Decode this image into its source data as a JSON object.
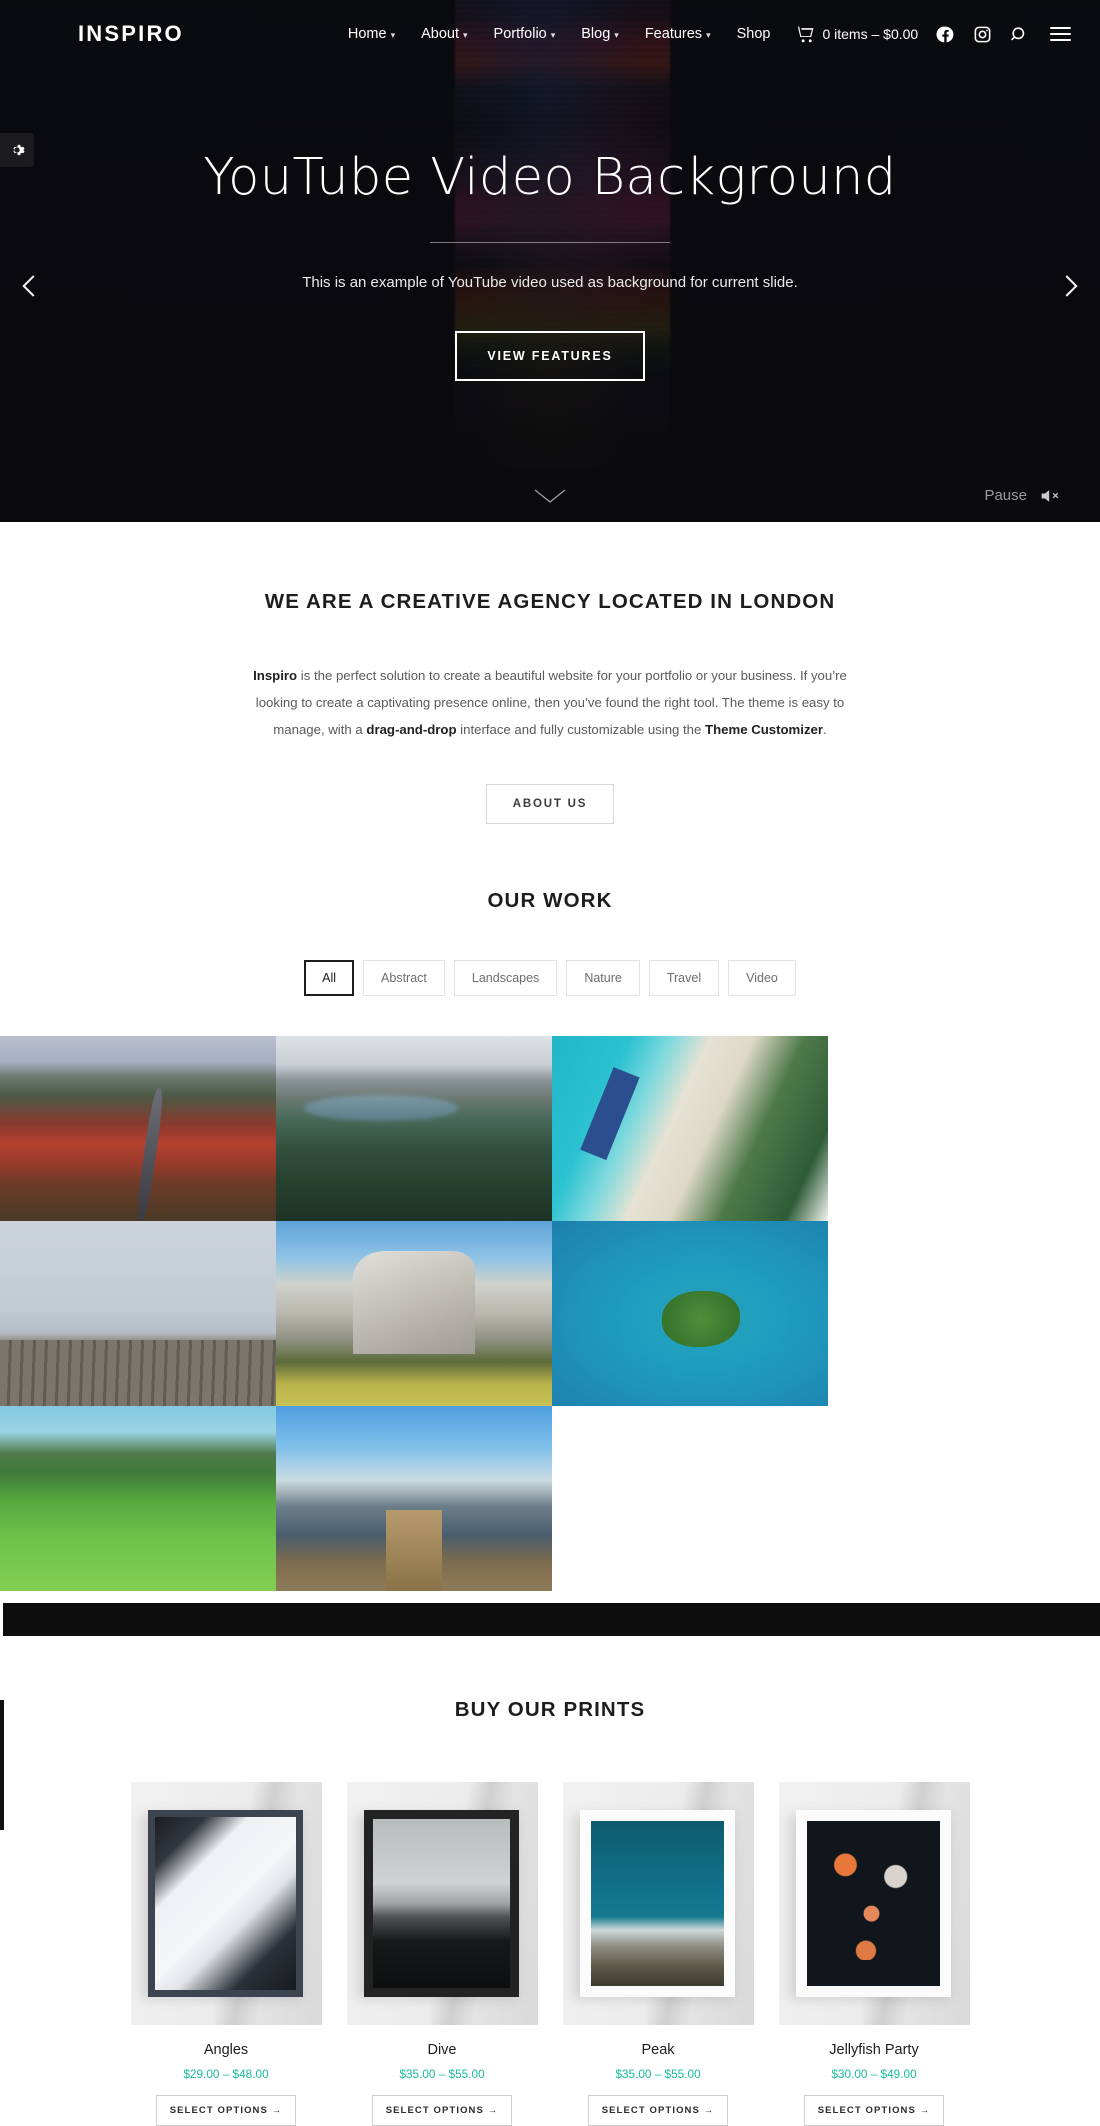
{
  "header": {
    "logo": "INSPIRO",
    "nav": [
      {
        "label": "Home",
        "caret": "⌄"
      },
      {
        "label": "About",
        "caret": "⌄"
      },
      {
        "label": "Portfolio",
        "caret": "⌄"
      },
      {
        "label": "Blog",
        "caret": "⌄"
      },
      {
        "label": "Features",
        "caret": "⌄"
      },
      {
        "label": "Shop",
        "caret": ""
      }
    ],
    "cart_label": "0 items – $0.00",
    "icons": [
      "cart-icon",
      "facebook-icon",
      "instagram-icon",
      "search-icon",
      "hamburger-menu-icon"
    ]
  },
  "hero": {
    "title": "YouTube Video Background",
    "subtitle": "This is an example of YouTube video used as background for current slide.",
    "button": "VIEW FEATURES",
    "pause_label": "Pause",
    "mute_state": "muted"
  },
  "intro": {
    "heading": "WE ARE A CREATIVE AGENCY LOCATED IN LONDON",
    "paragraph_part1": "Inspiro",
    "paragraph_part2": " is the perfect solution to create a beautiful website for your portfolio or your business. If you’re looking to create a captivating presence online, then you’ve found the right tool. The theme is easy to manage, with a ",
    "paragraph_part3": "drag-and-drop",
    "paragraph_part4": " interface and fully customizable using the ",
    "paragraph_part5": "Theme Customizer",
    "paragraph_part6": ".",
    "button": "ABOUT US"
  },
  "work": {
    "heading": "OUR WORK",
    "filters": [
      {
        "label": "All",
        "active": true
      },
      {
        "label": "Abstract",
        "active": false
      },
      {
        "label": "Landscapes",
        "active": false
      },
      {
        "label": "Nature",
        "active": false
      },
      {
        "label": "Travel",
        "active": false
      },
      {
        "label": "Video",
        "active": false
      }
    ],
    "tiles": [
      {
        "name": "autumn-mountain-road"
      },
      {
        "name": "alpine-lake-and-forest"
      },
      {
        "name": "tropical-beach-pier-aerial"
      },
      {
        "name": "wooden-dock-in-fog"
      },
      {
        "name": "granite-cliff-meadow"
      },
      {
        "name": "green-island-in-turquoise-sea"
      },
      {
        "name": "green-grass-field"
      },
      {
        "name": "venice-gondola-pier"
      }
    ]
  },
  "prints": {
    "heading": "BUY OUR PRINTS",
    "products": [
      {
        "name": "Angles",
        "price": "$29.00 – $48.00",
        "button": "SELECT OPTIONS  →",
        "art": "skyscrapers-looking-up"
      },
      {
        "name": "Dive",
        "price": "$35.00 – $55.00",
        "button": "SELECT OPTIONS  →",
        "art": "swimmer-in-water-bw"
      },
      {
        "name": "Peak",
        "price": "$35.00 – $55.00",
        "button": "SELECT OPTIONS  →",
        "art": "snowy-mountain-peak"
      },
      {
        "name": "Jellyfish Party",
        "price": "$30.00 – $49.00",
        "button": "SELECT OPTIONS  →",
        "art": "jellyfish-on-black"
      }
    ]
  },
  "colors": {
    "price_teal": "#1abc9c",
    "hero_bg": "#0c0d10",
    "text_dark": "#1d1d1d"
  }
}
